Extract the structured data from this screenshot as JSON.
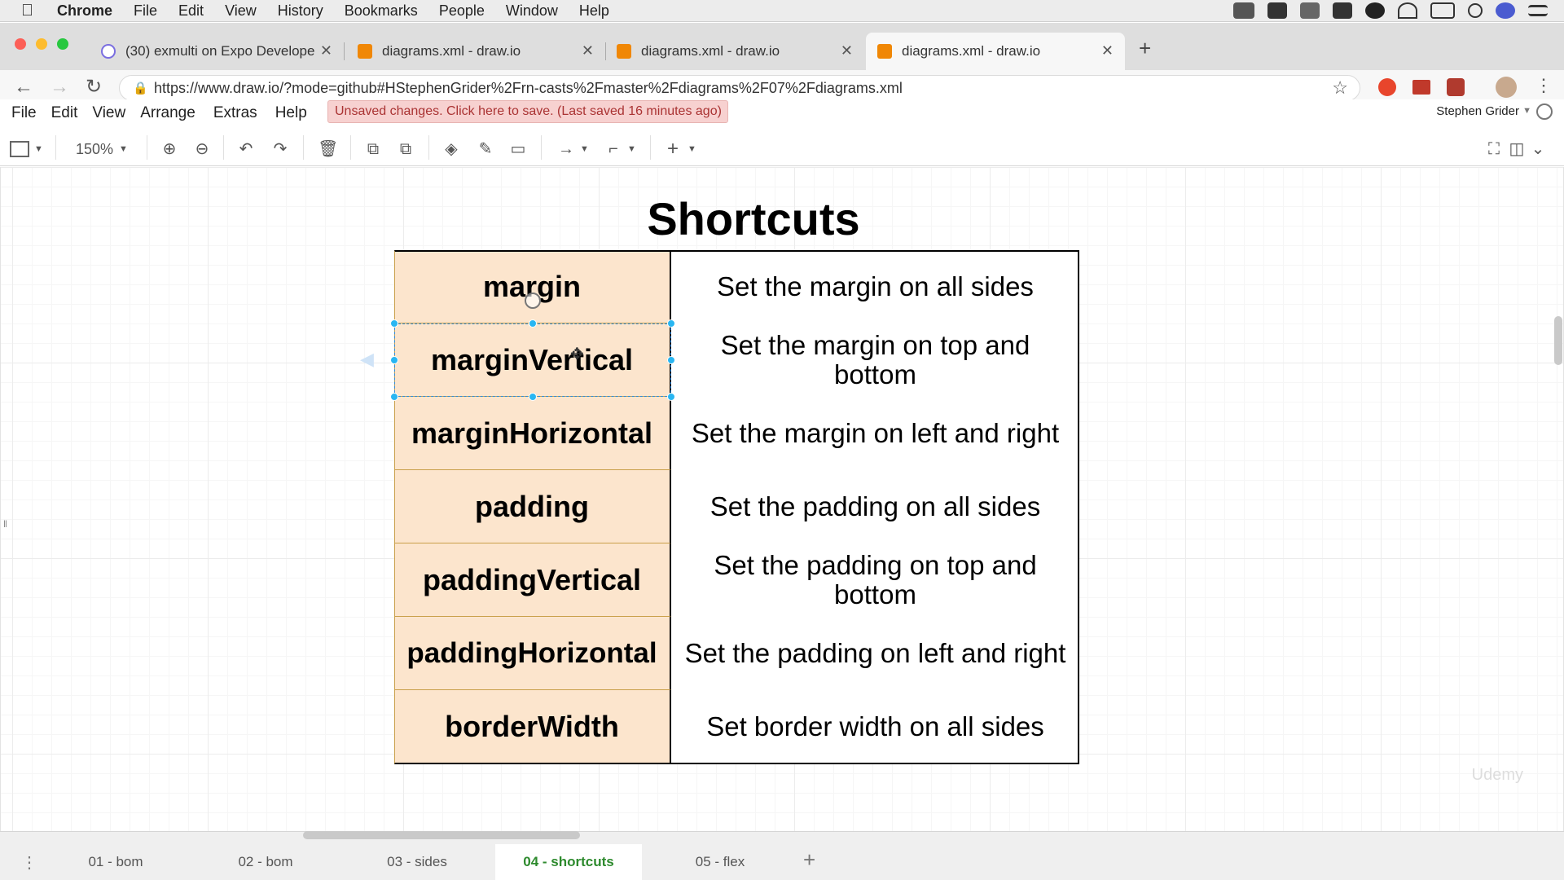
{
  "os_menubar": {
    "app": "Chrome",
    "items": [
      "File",
      "Edit",
      "View",
      "History",
      "Bookmarks",
      "People",
      "Window",
      "Help"
    ]
  },
  "browser": {
    "tabs": [
      {
        "title": "(30) exmulti on Expo Develope",
        "active": false
      },
      {
        "title": "diagrams.xml - draw.io",
        "active": false
      },
      {
        "title": "diagrams.xml - draw.io",
        "active": false
      },
      {
        "title": "diagrams.xml - draw.io",
        "active": true
      }
    ],
    "url": "https://www.draw.io/?mode=github#HStephenGrider%2Frn-casts%2Fmaster%2Fdiagrams%2F07%2Fdiagrams.xml"
  },
  "app_menu": {
    "items": [
      "File",
      "Edit",
      "View",
      "Arrange",
      "Extras",
      "Help"
    ]
  },
  "unsaved_notice": "Unsaved changes. Click here to save. (Last saved 16 minutes ago)",
  "user_name": "Stephen Grider",
  "toolbar": {
    "zoom": "150%"
  },
  "diagram": {
    "title": "Shortcuts",
    "rows": [
      {
        "key": "margin",
        "desc": "Set the margin on all sides"
      },
      {
        "key": "marginVertical",
        "desc": "Set the margin on top and bottom"
      },
      {
        "key": "marginHorizontal",
        "desc": "Set the margin on left and right"
      },
      {
        "key": "padding",
        "desc": "Set the padding on all sides"
      },
      {
        "key": "paddingVertical",
        "desc": "Set the padding on top and bottom"
      },
      {
        "key": "paddingHorizontal",
        "desc": "Set the padding on left and right"
      },
      {
        "key": "borderWidth",
        "desc": "Set border width on all sides"
      }
    ],
    "selected_row": 1
  },
  "watermark": "Udemy",
  "pages": [
    {
      "label": "01 - bom",
      "active": false
    },
    {
      "label": "02 - bom",
      "active": false
    },
    {
      "label": "03 - sides",
      "active": false
    },
    {
      "label": "04 - shortcuts",
      "active": true
    },
    {
      "label": "05 - flex",
      "active": false
    }
  ],
  "colors": {
    "key_fill": "#fce5cd",
    "selection": "#29b6f2",
    "active_page": "#2d8a2d",
    "unsaved_bg": "#f7d1d0"
  }
}
